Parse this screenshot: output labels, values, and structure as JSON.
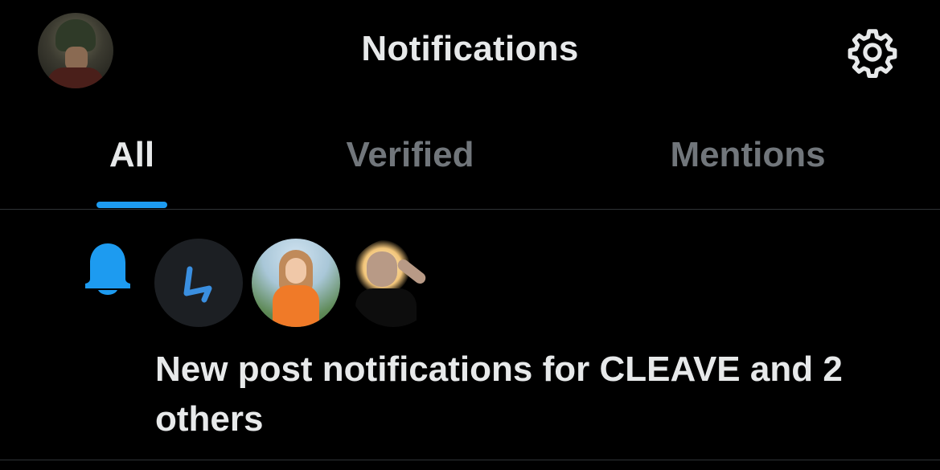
{
  "header": {
    "title": "Notifications",
    "avatar_icon": "user-avatar",
    "settings_icon": "gear-icon"
  },
  "tabs": [
    {
      "label": "All",
      "active": true
    },
    {
      "label": "Verified",
      "active": false
    },
    {
      "label": "Mentions",
      "active": false
    }
  ],
  "notifications": [
    {
      "icon": "bell-icon",
      "avatars": [
        "CLEAVE",
        "user-2",
        "user-3"
      ],
      "text": "New post notifications for CLEAVE and 2 others"
    }
  ],
  "colors": {
    "background": "#000000",
    "accent": "#1d9bf0",
    "text_primary": "#e7e9ea",
    "text_secondary": "#71767b",
    "divider": "#2f3336"
  }
}
